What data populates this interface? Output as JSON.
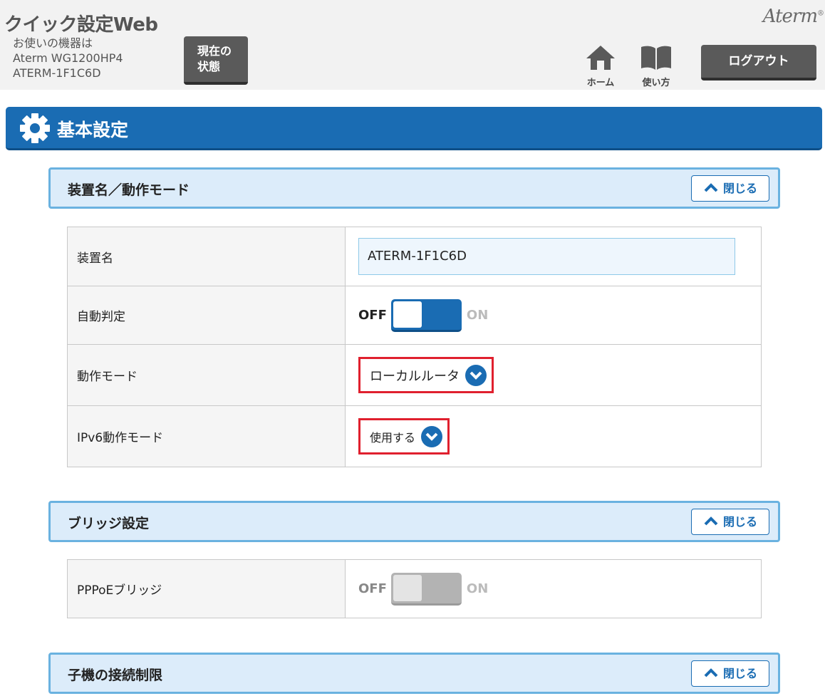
{
  "header": {
    "app_title": "クイック設定Web",
    "device_line1": "お使いの機器は",
    "device_line2": "Aterm WG1200HP4",
    "device_line3": "ATERM-1F1C6D",
    "status_button_line1": "現在の",
    "status_button_line2": "状態",
    "brand": "Aterm",
    "home_label": "ホーム",
    "help_label": "使い方",
    "logout_label": "ログアウト"
  },
  "banner": {
    "title": "基本設定"
  },
  "sections": [
    {
      "title": "装置名／動作モード",
      "close_label": "閉じる",
      "rows": {
        "device_name_label": "装置名",
        "device_name_value": "ATERM-1F1C6D",
        "auto_detect_label": "自動判定",
        "auto_detect_off": "OFF",
        "auto_detect_on": "ON",
        "auto_detect_state": "off",
        "operation_mode_label": "動作モード",
        "operation_mode_value": "ローカルルータ",
        "ipv6_mode_label": "IPv6動作モード",
        "ipv6_mode_value": "使用する"
      }
    },
    {
      "title": "ブリッジ設定",
      "close_label": "閉じる",
      "rows": {
        "pppoe_bridge_label": "PPPoEブリッジ",
        "pppoe_bridge_off": "OFF",
        "pppoe_bridge_on": "ON",
        "pppoe_bridge_state": "off-disabled"
      }
    },
    {
      "title": "子機の接続制限",
      "close_label": "閉じる"
    }
  ],
  "colors": {
    "accent": "#1a6cb3",
    "highlight": "#e0202e",
    "section_bg": "#dcecfa"
  }
}
